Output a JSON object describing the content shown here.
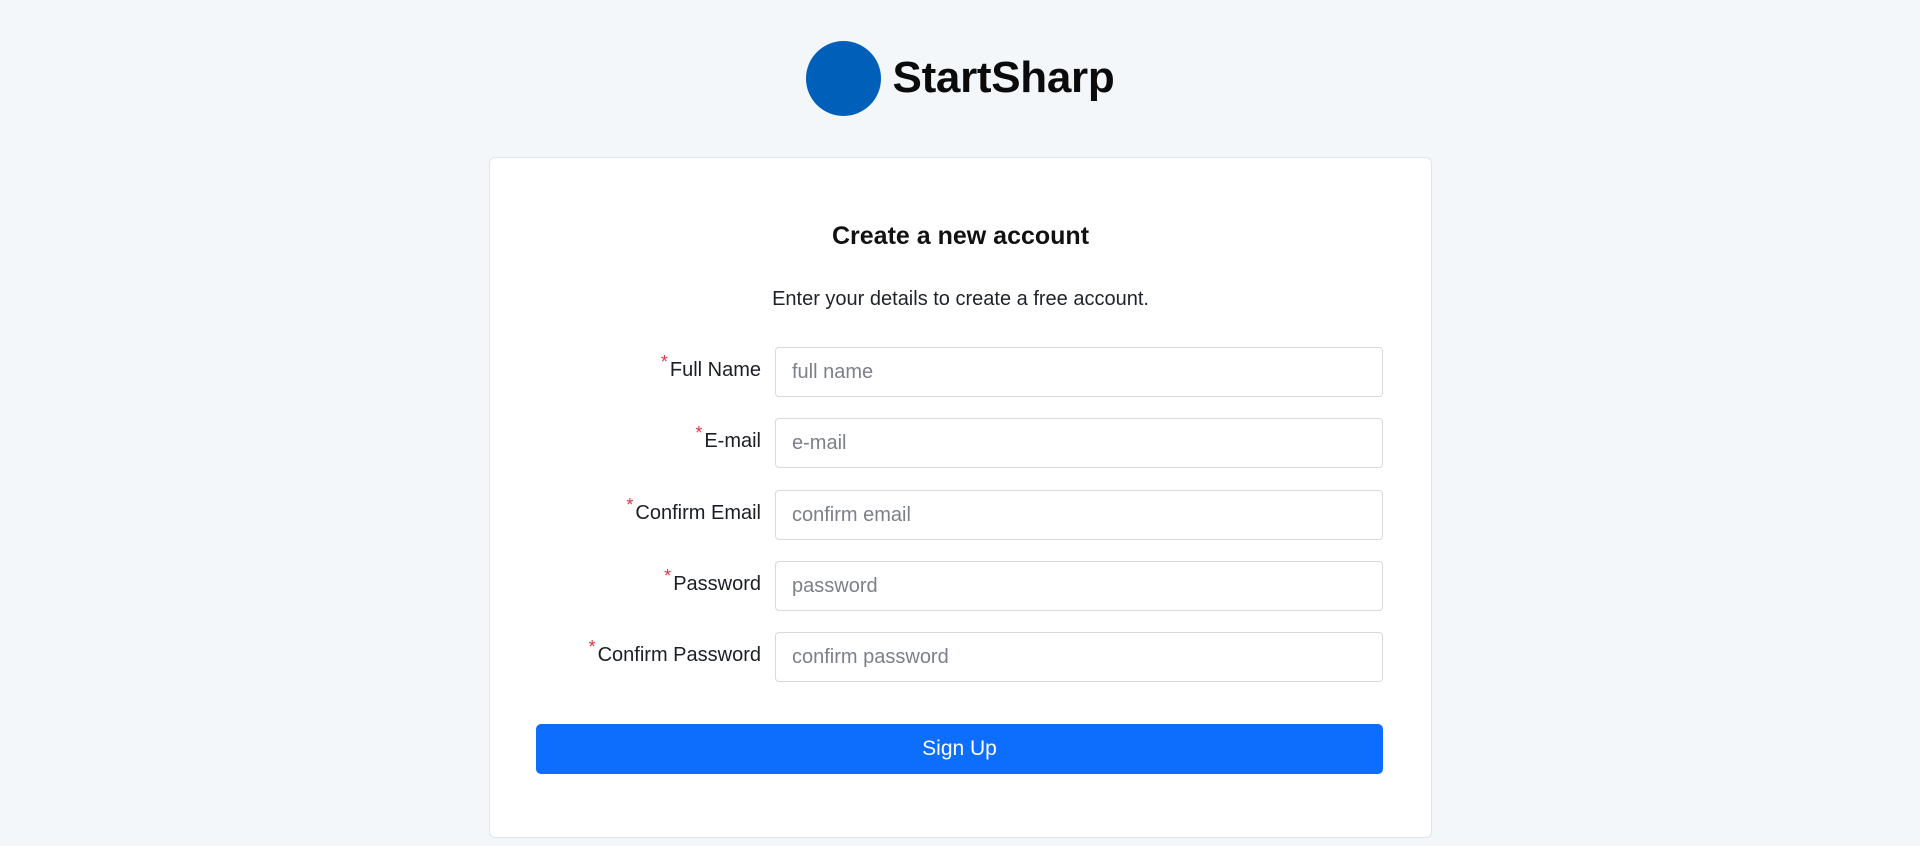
{
  "brand": {
    "name": "StartSharp",
    "logo_color": "#005fb8"
  },
  "card": {
    "title": "Create a new account",
    "subtitle": "Enter your details to create a free account."
  },
  "form": {
    "required_marker": "*",
    "fields": [
      {
        "label": "Full Name",
        "placeholder": "full name",
        "value": ""
      },
      {
        "label": "E-mail",
        "placeholder": "e-mail",
        "value": ""
      },
      {
        "label": "Confirm Email",
        "placeholder": "confirm email",
        "value": ""
      },
      {
        "label": "Password",
        "placeholder": "password",
        "value": ""
      },
      {
        "label": "Confirm Password",
        "placeholder": "confirm password",
        "value": ""
      }
    ],
    "submit_label": "Sign Up"
  },
  "colors": {
    "page_background": "#f4f7fa",
    "primary_button": "#0d6efd",
    "required_marker": "#dc3545"
  }
}
